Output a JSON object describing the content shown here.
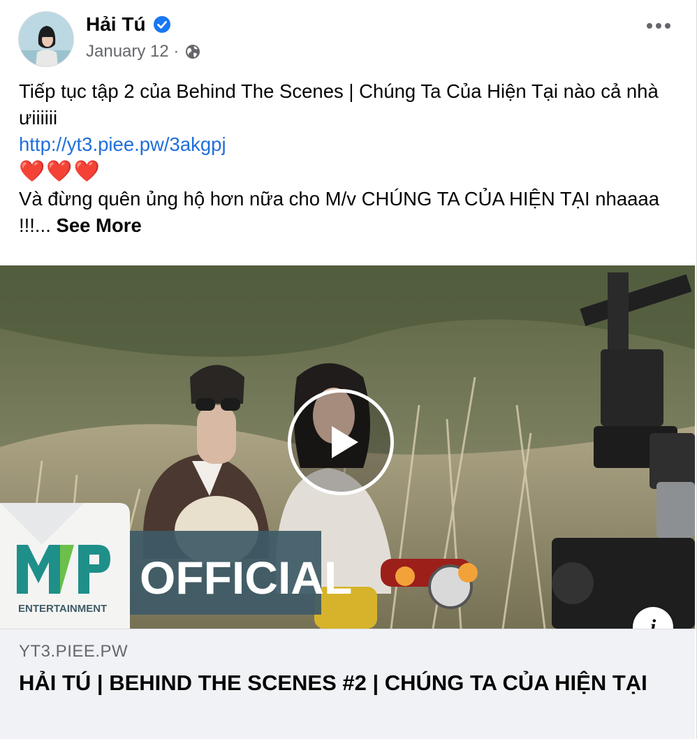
{
  "post": {
    "author": "Hải Tú",
    "date": "January 12 ·",
    "text_line1": "Tiếp tục tập 2 của Behind The Scenes | Chúng Ta Của Hiện Tại nào cả nhà ưiiiiii",
    "link": "http://yt3.piee.pw/3akgpj",
    "hearts": "❤️❤️❤️",
    "text_line2": "Và đừng quên ủng hộ hơn nữa cho M/v CHÚNG TA CỦA HIỆN TẠI nhaaaa !!!...",
    "see_more": "See More"
  },
  "video": {
    "logo_text": "M P",
    "logo_sub": "ENTERTAINMENT",
    "banner_text": "OFFICIAL"
  },
  "link_preview": {
    "domain": "YT3.PIEE.PW",
    "title": "HẢI TÚ | BEHIND THE SCENES #2 | CHÚNG TA CỦA HIỆN TẠI"
  },
  "icons": {
    "verified": "verified-badge-icon",
    "audience": "globe-icon",
    "more": "more-options-icon",
    "play": "play-icon",
    "info": "info-icon"
  },
  "colors": {
    "link": "#216fdb",
    "verified": "#1877f2",
    "secondary_text": "#65676b",
    "card_bg": "#f0f2f5"
  }
}
